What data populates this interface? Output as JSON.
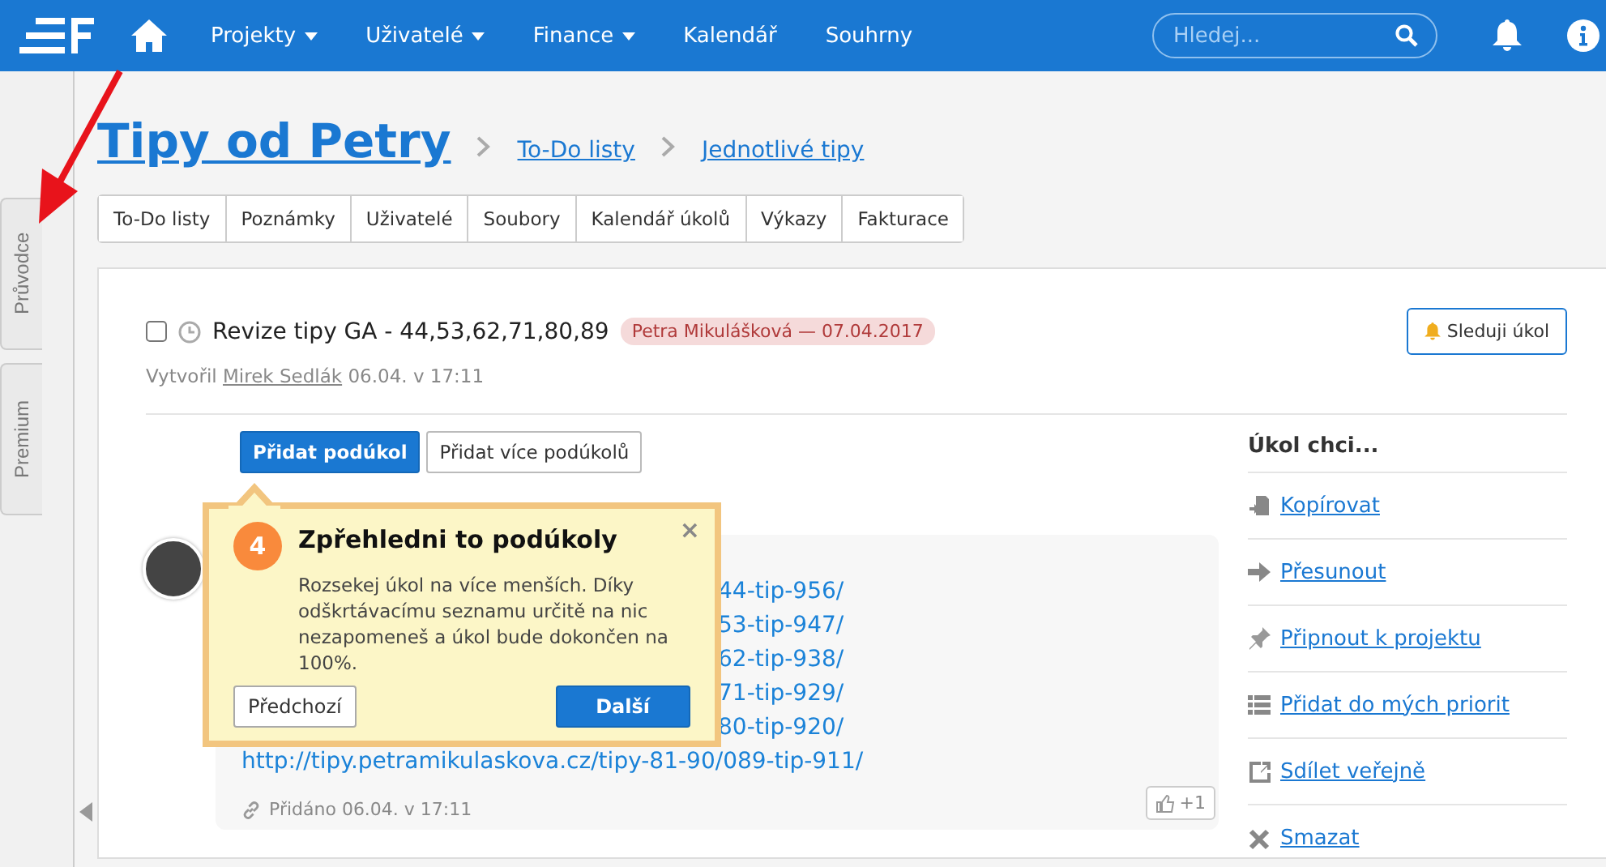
{
  "navbar": {
    "items": [
      {
        "label": "Projekty",
        "dropdown": true
      },
      {
        "label": "Uživatelé",
        "dropdown": true
      },
      {
        "label": "Finance",
        "dropdown": true
      },
      {
        "label": "Kalendář",
        "dropdown": false
      },
      {
        "label": "Souhrny",
        "dropdown": false
      }
    ],
    "search": {
      "placeholder": "Hledej..."
    }
  },
  "side_tabs": [
    "Průvodce",
    "Premium"
  ],
  "page_title": "Tipy od Petry",
  "breadcrumbs": [
    "To-Do listy",
    "Jednotlivé tipy"
  ],
  "tabs": [
    "To-Do listy",
    "Poznámky",
    "Uživatelé",
    "Soubory",
    "Kalendář úkolů",
    "Výkazy",
    "Fakturace"
  ],
  "task": {
    "checked": false,
    "title": "Revize tipy GA - 44,53,62,71,80,89",
    "assignee_badge": "Petra Mikulášková — 07.04.2017",
    "created_label": "Vytvořil",
    "creator": "Mirek Sedlák",
    "created_time": "06.04. v 17:11",
    "follow_button": "Sleduji úkol"
  },
  "subtask_buttons": [
    {
      "label": "Přidat podúkol",
      "primary": true
    },
    {
      "label": "Přidat více podúkolů",
      "primary": false
    }
  ],
  "comment": {
    "links": [
      "44-tip-956/",
      "53-tip-947/",
      "62-tip-938/",
      "71-tip-929/",
      "80-tip-920/",
      "http://tipy.petramikulaskova.cz/tipy-81-90/089-tip-911/"
    ],
    "added": "Přidáno 06.04. v 17:11",
    "like": "+1"
  },
  "actions": {
    "title": "Úkol chci...",
    "items": [
      {
        "label": "Kopírovat",
        "kind": "copy"
      },
      {
        "label": "Přesunout",
        "kind": "move"
      },
      {
        "label": "Připnout k projektu",
        "kind": "pin"
      },
      {
        "label": "Přidat do mých priorit",
        "kind": "priority"
      },
      {
        "label": "Sdílet veřejně",
        "kind": "share"
      },
      {
        "label": "Smazat",
        "kind": "delete"
      }
    ]
  },
  "tour_popover": {
    "step": "4",
    "title": "Zpřehledni to podúkoly",
    "text": "Rozsekej úkol na více menších. Díky odškrtávacímu seznamu určitě na nic nezapomeneš a úkol bude dokončen na 100%.",
    "buttons": [
      {
        "label": "Předchozí",
        "primary": false
      },
      {
        "label": "Další",
        "primary": true
      }
    ],
    "close": "×"
  }
}
